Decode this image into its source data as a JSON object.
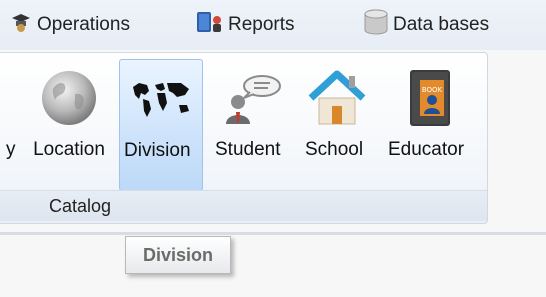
{
  "menu": {
    "tabs": [
      {
        "label": "Operations",
        "icon": "operations-icon"
      },
      {
        "label": "Reports",
        "icon": "reports-book-icon"
      },
      {
        "label": "Data bases",
        "icon": "database-icon"
      }
    ]
  },
  "ribbon": {
    "group_label": "Catalog",
    "buttons": [
      {
        "label": "y",
        "icon": "partial-item"
      },
      {
        "label": "Location",
        "icon": "globe-icon"
      },
      {
        "label": "Division",
        "icon": "world-map-icon",
        "selected": true
      },
      {
        "label": "Student",
        "icon": "student-speech-icon"
      },
      {
        "label": "School",
        "icon": "house-icon"
      },
      {
        "label": "Educator",
        "icon": "book-person-icon"
      }
    ]
  },
  "tooltip": {
    "text": "Division"
  },
  "colors": {
    "selected_fill": "#cfe4fb",
    "selected_border": "#9fc3ea",
    "tooltip_text": "#6b6b6b"
  }
}
